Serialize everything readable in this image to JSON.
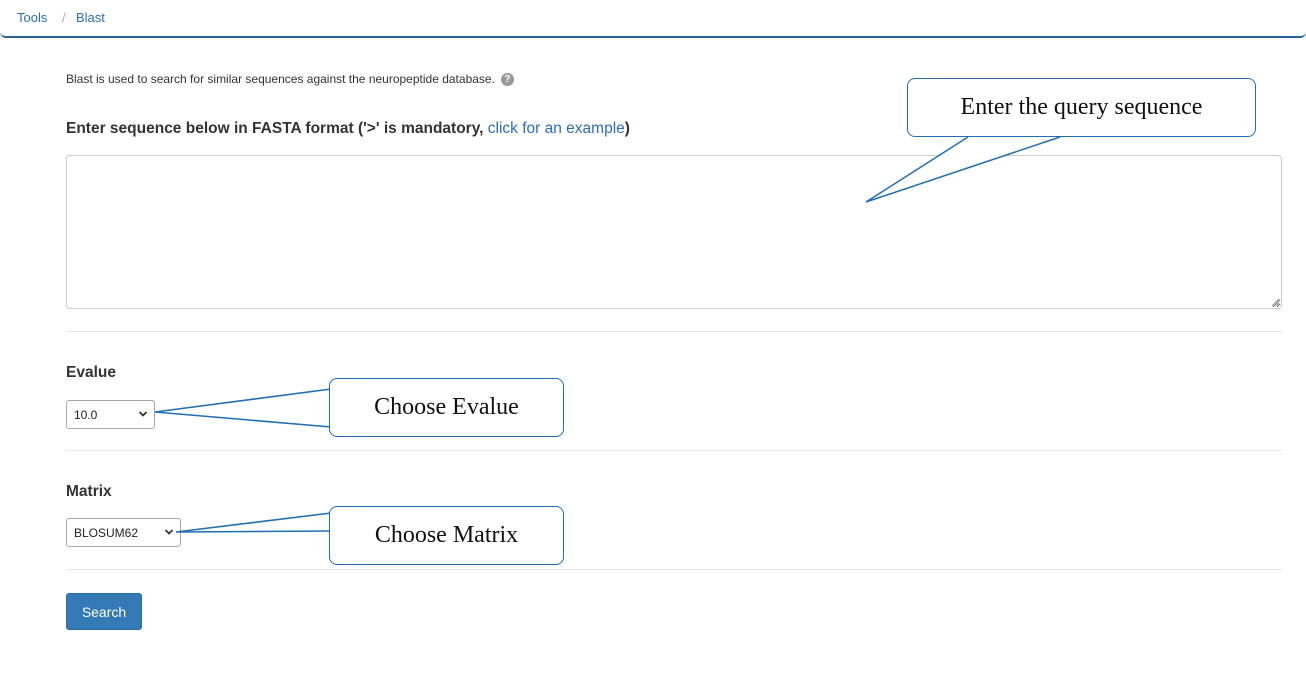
{
  "breadcrumb": {
    "items": [
      "Tools",
      "Blast"
    ],
    "separator": "/"
  },
  "intro": {
    "text": "Blast is used to search for similar sequences against the neuropeptide database.",
    "help_icon": "question-circle-icon"
  },
  "sequence": {
    "heading_prefix": "Enter sequence below in FASTA format ('>' is mandatory, ",
    "example_link": "click for an example",
    "heading_suffix": ")",
    "value": ""
  },
  "evalue": {
    "label": "Evalue",
    "selected": "10.0"
  },
  "matrix": {
    "label": "Matrix",
    "selected": "BLOSUM62"
  },
  "search_button": {
    "label": "Search"
  },
  "callouts": {
    "sequence": "Enter the query sequence",
    "evalue": "Choose Evalue",
    "matrix": "Choose Matrix"
  },
  "colors": {
    "link": "#2a6fb5",
    "primary_button": "#337ab7",
    "callout_border": "#1f6fb2",
    "header_border": "#2a6496"
  }
}
